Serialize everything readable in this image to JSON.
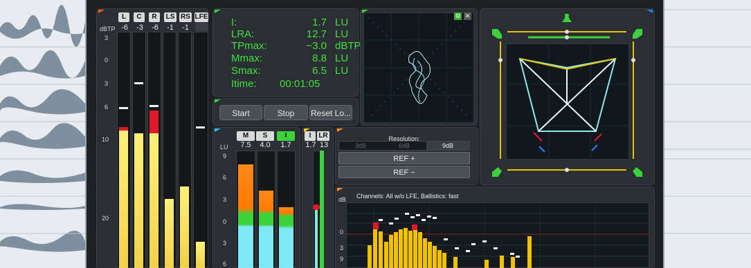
{
  "meter_headers": {
    "channels": [
      "L",
      "C",
      "R",
      "LS",
      "RS",
      "LFE"
    ],
    "values": [
      "-6",
      "-3",
      "-6",
      "-1",
      "-1",
      ""
    ],
    "unit": "dBTP",
    "scale": [
      "3",
      "0",
      "3",
      "6",
      "10",
      "20"
    ]
  },
  "stats": {
    "rows": [
      {
        "k": "I:",
        "v": "1.7",
        "u": "LU"
      },
      {
        "k": "LRA:",
        "v": "12.7",
        "u": "LU"
      },
      {
        "k": "TPmax:",
        "v": "−3.0",
        "u": "dBTP"
      },
      {
        "k": "Mmax:",
        "v": "8.8",
        "u": "LU"
      },
      {
        "k": "Smax:",
        "v": "6.5",
        "u": "LU"
      },
      {
        "k": "Itime:",
        "v": "00:01:05",
        "u": ""
      }
    ]
  },
  "controls": {
    "start": "Start",
    "stop": "Stop",
    "reset": "Reset Lo..."
  },
  "loudness": {
    "headers": [
      "M",
      "S",
      "I"
    ],
    "values": [
      "7.5",
      "4.0",
      "1.7"
    ],
    "unit": "LU",
    "scale": [
      "9",
      "6",
      "3",
      "0",
      "3",
      "6"
    ],
    "lra_headers": [
      "I",
      "LR"
    ],
    "lra_values": [
      "1.7",
      "13"
    ]
  },
  "resolution": {
    "title": "Resolution:",
    "options": [
      "3dB",
      "6dB",
      "9dB"
    ],
    "selected": "9dB",
    "ref_plus": "REF +",
    "ref_minus": "REF −"
  },
  "histogram": {
    "caption": "Channels: All w/o LFE, Ballistics: fast",
    "unit": "dB",
    "scale": [
      "0",
      "3",
      "9"
    ]
  },
  "vectorscope": {
    "settings_icon": "⚙",
    "close_icon": "✕"
  },
  "colors": {
    "accent_green": "#3fe03f",
    "meter_yellow": "#f5e06a",
    "peak_red": "#e0192a",
    "scope_cyan": "#7fe3e8"
  }
}
